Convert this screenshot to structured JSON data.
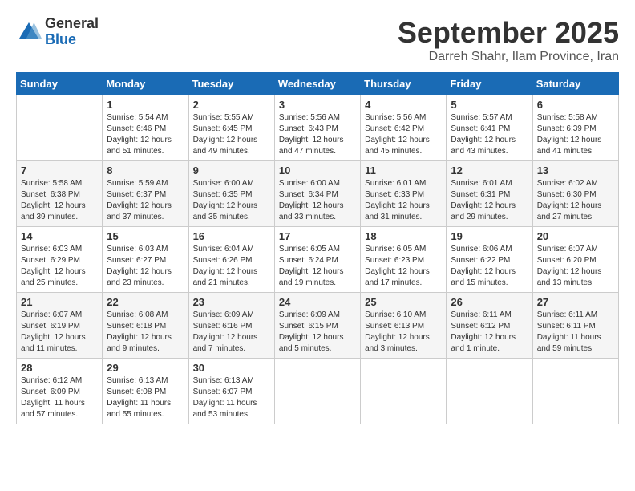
{
  "header": {
    "logo_general": "General",
    "logo_blue": "Blue",
    "month_title": "September 2025",
    "location": "Darreh Shahr, Ilam Province, Iran"
  },
  "weekdays": [
    "Sunday",
    "Monday",
    "Tuesday",
    "Wednesday",
    "Thursday",
    "Friday",
    "Saturday"
  ],
  "weeks": [
    [
      {
        "day": "",
        "info": ""
      },
      {
        "day": "1",
        "info": "Sunrise: 5:54 AM\nSunset: 6:46 PM\nDaylight: 12 hours\nand 51 minutes."
      },
      {
        "day": "2",
        "info": "Sunrise: 5:55 AM\nSunset: 6:45 PM\nDaylight: 12 hours\nand 49 minutes."
      },
      {
        "day": "3",
        "info": "Sunrise: 5:56 AM\nSunset: 6:43 PM\nDaylight: 12 hours\nand 47 minutes."
      },
      {
        "day": "4",
        "info": "Sunrise: 5:56 AM\nSunset: 6:42 PM\nDaylight: 12 hours\nand 45 minutes."
      },
      {
        "day": "5",
        "info": "Sunrise: 5:57 AM\nSunset: 6:41 PM\nDaylight: 12 hours\nand 43 minutes."
      },
      {
        "day": "6",
        "info": "Sunrise: 5:58 AM\nSunset: 6:39 PM\nDaylight: 12 hours\nand 41 minutes."
      }
    ],
    [
      {
        "day": "7",
        "info": "Sunrise: 5:58 AM\nSunset: 6:38 PM\nDaylight: 12 hours\nand 39 minutes."
      },
      {
        "day": "8",
        "info": "Sunrise: 5:59 AM\nSunset: 6:37 PM\nDaylight: 12 hours\nand 37 minutes."
      },
      {
        "day": "9",
        "info": "Sunrise: 6:00 AM\nSunset: 6:35 PM\nDaylight: 12 hours\nand 35 minutes."
      },
      {
        "day": "10",
        "info": "Sunrise: 6:00 AM\nSunset: 6:34 PM\nDaylight: 12 hours\nand 33 minutes."
      },
      {
        "day": "11",
        "info": "Sunrise: 6:01 AM\nSunset: 6:33 PM\nDaylight: 12 hours\nand 31 minutes."
      },
      {
        "day": "12",
        "info": "Sunrise: 6:01 AM\nSunset: 6:31 PM\nDaylight: 12 hours\nand 29 minutes."
      },
      {
        "day": "13",
        "info": "Sunrise: 6:02 AM\nSunset: 6:30 PM\nDaylight: 12 hours\nand 27 minutes."
      }
    ],
    [
      {
        "day": "14",
        "info": "Sunrise: 6:03 AM\nSunset: 6:29 PM\nDaylight: 12 hours\nand 25 minutes."
      },
      {
        "day": "15",
        "info": "Sunrise: 6:03 AM\nSunset: 6:27 PM\nDaylight: 12 hours\nand 23 minutes."
      },
      {
        "day": "16",
        "info": "Sunrise: 6:04 AM\nSunset: 6:26 PM\nDaylight: 12 hours\nand 21 minutes."
      },
      {
        "day": "17",
        "info": "Sunrise: 6:05 AM\nSunset: 6:24 PM\nDaylight: 12 hours\nand 19 minutes."
      },
      {
        "day": "18",
        "info": "Sunrise: 6:05 AM\nSunset: 6:23 PM\nDaylight: 12 hours\nand 17 minutes."
      },
      {
        "day": "19",
        "info": "Sunrise: 6:06 AM\nSunset: 6:22 PM\nDaylight: 12 hours\nand 15 minutes."
      },
      {
        "day": "20",
        "info": "Sunrise: 6:07 AM\nSunset: 6:20 PM\nDaylight: 12 hours\nand 13 minutes."
      }
    ],
    [
      {
        "day": "21",
        "info": "Sunrise: 6:07 AM\nSunset: 6:19 PM\nDaylight: 12 hours\nand 11 minutes."
      },
      {
        "day": "22",
        "info": "Sunrise: 6:08 AM\nSunset: 6:18 PM\nDaylight: 12 hours\nand 9 minutes."
      },
      {
        "day": "23",
        "info": "Sunrise: 6:09 AM\nSunset: 6:16 PM\nDaylight: 12 hours\nand 7 minutes."
      },
      {
        "day": "24",
        "info": "Sunrise: 6:09 AM\nSunset: 6:15 PM\nDaylight: 12 hours\nand 5 minutes."
      },
      {
        "day": "25",
        "info": "Sunrise: 6:10 AM\nSunset: 6:13 PM\nDaylight: 12 hours\nand 3 minutes."
      },
      {
        "day": "26",
        "info": "Sunrise: 6:11 AM\nSunset: 6:12 PM\nDaylight: 12 hours\nand 1 minute."
      },
      {
        "day": "27",
        "info": "Sunrise: 6:11 AM\nSunset: 6:11 PM\nDaylight: 11 hours\nand 59 minutes."
      }
    ],
    [
      {
        "day": "28",
        "info": "Sunrise: 6:12 AM\nSunset: 6:09 PM\nDaylight: 11 hours\nand 57 minutes."
      },
      {
        "day": "29",
        "info": "Sunrise: 6:13 AM\nSunset: 6:08 PM\nDaylight: 11 hours\nand 55 minutes."
      },
      {
        "day": "30",
        "info": "Sunrise: 6:13 AM\nSunset: 6:07 PM\nDaylight: 11 hours\nand 53 minutes."
      },
      {
        "day": "",
        "info": ""
      },
      {
        "day": "",
        "info": ""
      },
      {
        "day": "",
        "info": ""
      },
      {
        "day": "",
        "info": ""
      }
    ]
  ]
}
